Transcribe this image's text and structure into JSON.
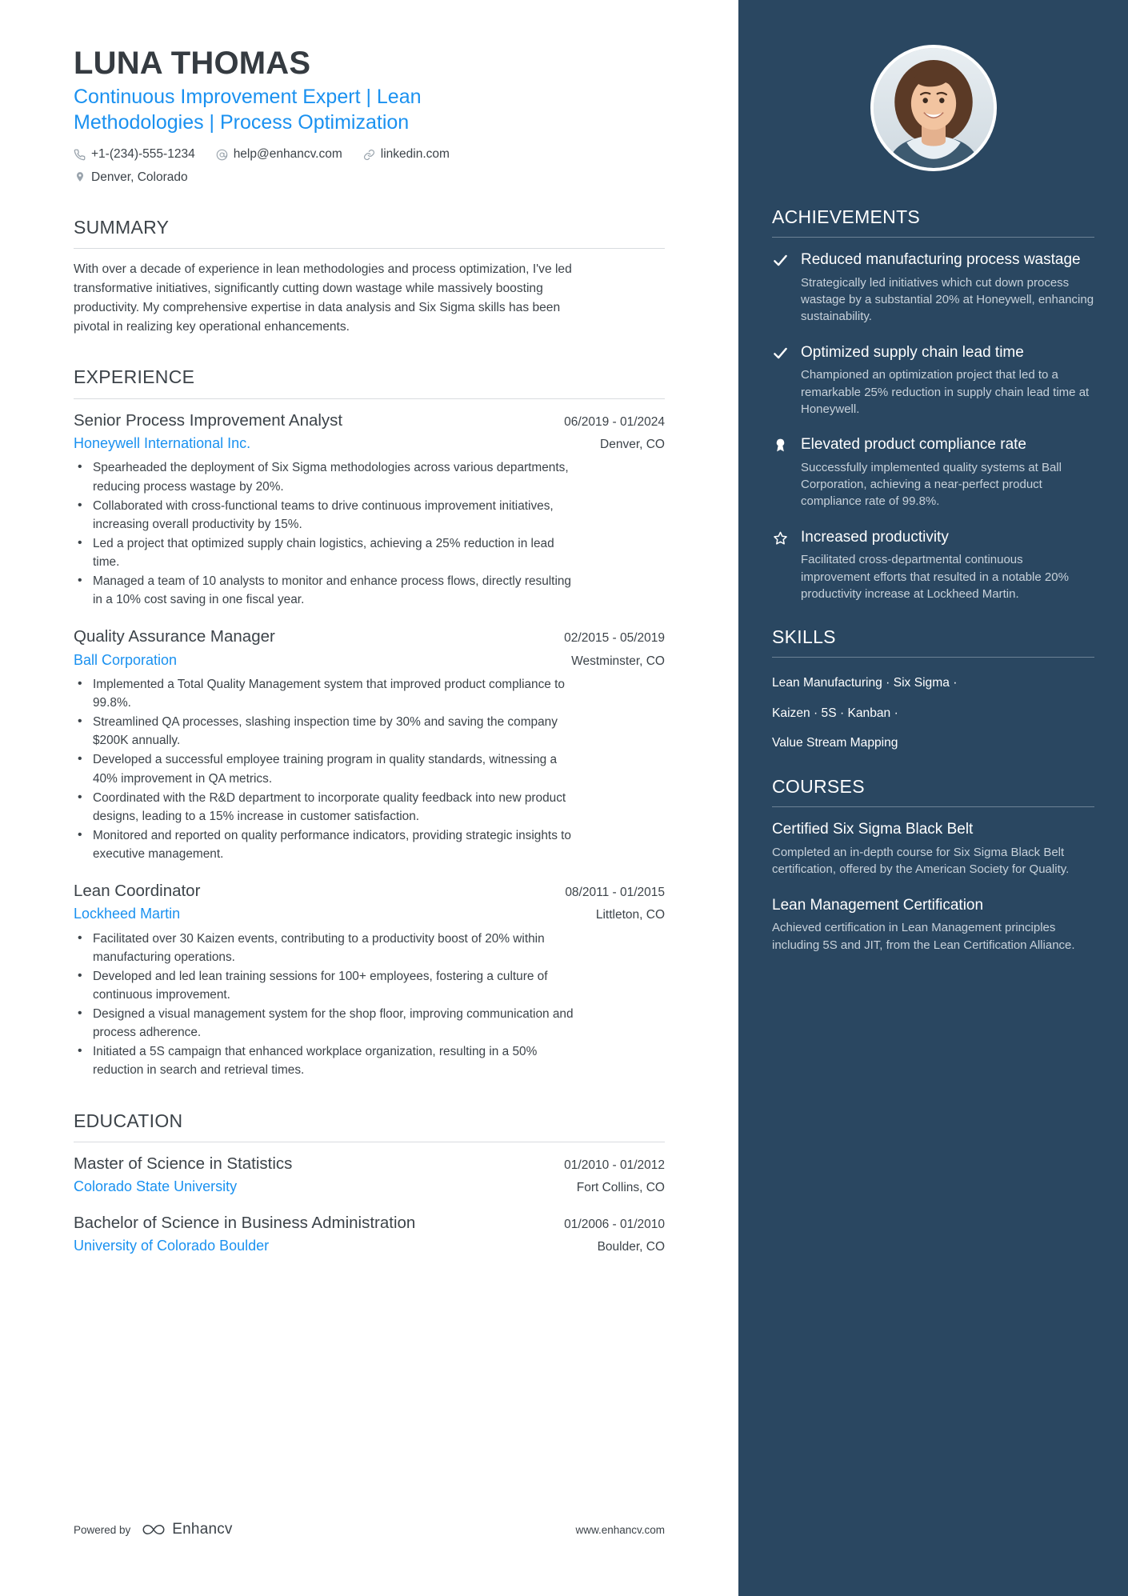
{
  "colors": {
    "accent_blue": "#1a91f0",
    "sidebar_bg": "#2a4761",
    "text_dark": "#3c4349",
    "muted_side_text": "#c7d1da",
    "rule": "#d8dcdf"
  },
  "header": {
    "name": "LUNA THOMAS",
    "headline": "Continuous Improvement Expert | Lean Methodologies | Process Optimization",
    "contacts": [
      {
        "icon": "phone-icon",
        "text": "+1-(234)-555-1234"
      },
      {
        "icon": "email-icon",
        "text": "help@enhancv.com"
      },
      {
        "icon": "link-icon",
        "text": "linkedin.com"
      }
    ],
    "location": {
      "icon": "location-pin-icon",
      "text": "Denver, Colorado"
    }
  },
  "summary": {
    "title": "SUMMARY",
    "text": "With over a decade of experience in lean methodologies and process optimization, I've led transformative initiatives, significantly cutting down wastage while massively boosting productivity. My comprehensive expertise in data analysis and Six Sigma skills has been pivotal in realizing key operational enhancements."
  },
  "experience": {
    "title": "EXPERIENCE",
    "entries": [
      {
        "role": "Senior Process Improvement Analyst",
        "dates": "06/2019 - 01/2024",
        "company": "Honeywell International Inc.",
        "location": "Denver, CO",
        "bullets": [
          "Spearheaded the deployment of Six Sigma methodologies across various departments, reducing process wastage by 20%.",
          "Collaborated with cross-functional teams to drive continuous improvement initiatives, increasing overall productivity by 15%.",
          "Led a project that optimized supply chain logistics, achieving a 25% reduction in lead time.",
          "Managed a team of 10 analysts to monitor and enhance process flows, directly resulting in a 10% cost saving in one fiscal year."
        ]
      },
      {
        "role": "Quality Assurance Manager",
        "dates": "02/2015 - 05/2019",
        "company": "Ball Corporation",
        "location": "Westminster, CO",
        "bullets": [
          "Implemented a Total Quality Management system that improved product compliance to 99.8%.",
          "Streamlined QA processes, slashing inspection time by 30% and saving the company $200K annually.",
          "Developed a successful employee training program in quality standards, witnessing a 40% improvement in QA metrics.",
          "Coordinated with the R&D department to incorporate quality feedback into new product designs, leading to a 15% increase in customer satisfaction.",
          "Monitored and reported on quality performance indicators, providing strategic insights to executive management."
        ]
      },
      {
        "role": "Lean Coordinator",
        "dates": "08/2011 - 01/2015",
        "company": "Lockheed Martin",
        "location": "Littleton, CO",
        "bullets": [
          "Facilitated over 30 Kaizen events, contributing to a productivity boost of 20% within manufacturing operations.",
          "Developed and led lean training sessions for 100+ employees, fostering a culture of continuous improvement.",
          "Designed a visual management system for the shop floor, improving communication and process adherence.",
          "Initiated a 5S campaign that enhanced workplace organization, resulting in a 50% reduction in search and retrieval times."
        ]
      }
    ]
  },
  "education": {
    "title": "EDUCATION",
    "entries": [
      {
        "degree": "Master of Science in Statistics",
        "dates": "01/2010 - 01/2012",
        "school": "Colorado State University",
        "location": "Fort Collins, CO"
      },
      {
        "degree": "Bachelor of Science in Business Administration",
        "dates": "01/2006 - 01/2010",
        "school": "University of Colorado Boulder",
        "location": "Boulder, CO"
      }
    ]
  },
  "footer": {
    "powered_by": "Powered by",
    "brand": "Enhancv",
    "url": "www.enhancv.com"
  },
  "sidebar": {
    "achievements": {
      "title": "ACHIEVEMENTS",
      "items": [
        {
          "icon": "check-icon",
          "title": "Reduced manufacturing process wastage",
          "desc": "Strategically led initiatives which cut down process wastage by a substantial 20% at Honeywell, enhancing sustainability."
        },
        {
          "icon": "check-icon",
          "title": "Optimized supply chain lead time",
          "desc": "Championed an optimization project that led to a remarkable 25% reduction in supply chain lead time at Honeywell."
        },
        {
          "icon": "medal-icon",
          "title": "Elevated product compliance rate",
          "desc": "Successfully implemented quality systems at Ball Corporation, achieving a near-perfect product compliance rate of 99.8%."
        },
        {
          "icon": "star-icon",
          "title": "Increased productivity",
          "desc": "Facilitated cross-departmental continuous improvement efforts that resulted in a notable 20% productivity increase at Lockheed Martin."
        }
      ]
    },
    "skills": {
      "title": "SKILLS",
      "lines": [
        "Lean Manufacturing · Six Sigma ·",
        "Kaizen · 5S · Kanban ·",
        "Value Stream Mapping"
      ]
    },
    "courses": {
      "title": "COURSES",
      "items": [
        {
          "title": "Certified Six Sigma Black Belt",
          "desc": "Completed an in-depth course for Six Sigma Black Belt certification, offered by the American Society for Quality."
        },
        {
          "title": "Lean Management Certification",
          "desc": "Achieved certification in Lean Management principles including 5S and JIT, from the Lean Certification Alliance."
        }
      ]
    }
  }
}
